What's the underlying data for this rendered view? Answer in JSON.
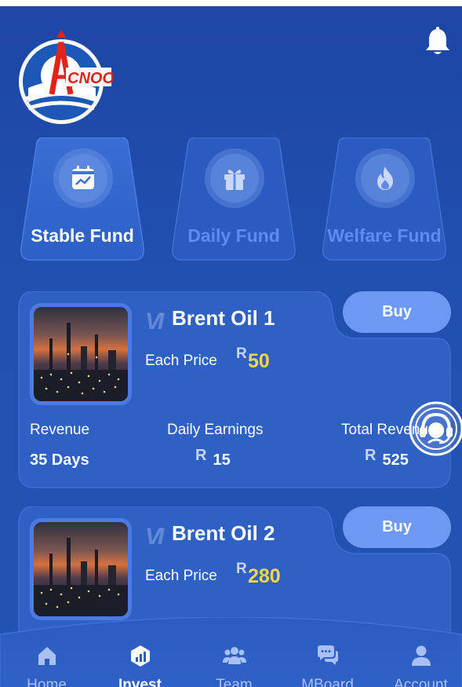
{
  "header": {
    "logo_text": "CNOOC",
    "logo_icon": "company-logo",
    "bell_icon": "bell-icon"
  },
  "funds": [
    {
      "label": "Stable Fund",
      "icon": "calendar-chart-icon",
      "active": true
    },
    {
      "label": "Daily Fund",
      "icon": "gift-icon",
      "active": false
    },
    {
      "label": "Welfare Fund",
      "icon": "flame-icon",
      "active": false
    }
  ],
  "products": [
    {
      "badge": "VI",
      "name": "Brent Oil 1",
      "price_label": "Each Price",
      "currency": "R",
      "price": "50",
      "buy_label": "Buy",
      "revenue_label": "Revenue",
      "revenue_value": "35 Days",
      "daily_label": "Daily Earnings",
      "daily_value": "15",
      "total_label": "Total Revenue",
      "total_value": "525"
    },
    {
      "badge": "VI",
      "name": "Brent Oil 2",
      "price_label": "Each Price",
      "currency": "R",
      "price": "280",
      "buy_label": "Buy"
    }
  ],
  "support_icon": "customer-support-icon",
  "nav": [
    {
      "label": "Home",
      "icon": "home-icon"
    },
    {
      "label": "Invest",
      "icon": "invest-icon",
      "active": true
    },
    {
      "label": "Team",
      "icon": "team-icon"
    },
    {
      "label": "MBoard",
      "icon": "chat-icon"
    },
    {
      "label": "Account",
      "icon": "user-icon"
    }
  ],
  "colors": {
    "background": "#2150b0",
    "card": "#2e5fc2",
    "buy": "#6d99f2",
    "price": "#f7d749",
    "inactive_tab": "#5b8df0"
  }
}
